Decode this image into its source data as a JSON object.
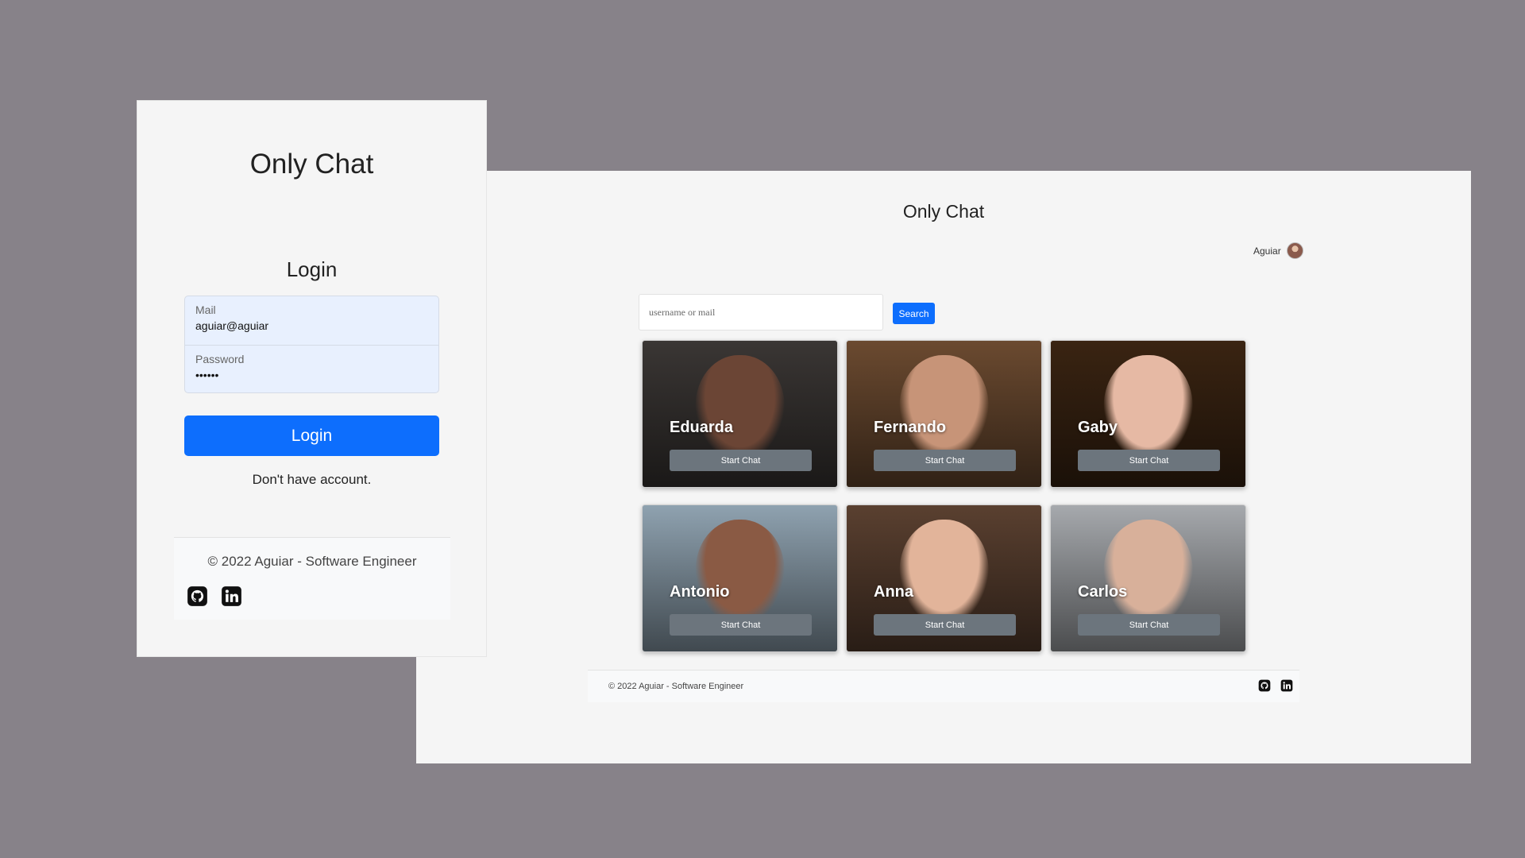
{
  "main": {
    "title": "Only Chat",
    "user": {
      "name": "Aguiar"
    },
    "search": {
      "placeholder": "username or mail",
      "button_label": "Search"
    },
    "cards": [
      {
        "name": "Eduarda",
        "button_label": "Start Chat",
        "bg": "#3a3634",
        "face": "#6b4535"
      },
      {
        "name": "Fernando",
        "button_label": "Start Chat",
        "bg": "#6b4a30",
        "face": "#c79478"
      },
      {
        "name": "Gaby",
        "button_label": "Start Chat",
        "bg": "#3a2412",
        "face": "#e6b9a4"
      },
      {
        "name": "Antonio",
        "button_label": "Start Chat",
        "bg": "#8fa2b0",
        "face": "#8a5a44"
      },
      {
        "name": "Anna",
        "button_label": "Start Chat",
        "bg": "#5a4030",
        "face": "#e2b49a"
      },
      {
        "name": "Carlos",
        "button_label": "Start Chat",
        "bg": "#a6a9ad",
        "face": "#d8b09a"
      }
    ],
    "footer": {
      "copyright": "© 2022 Aguiar - Software Engineer"
    }
  },
  "login": {
    "app_title": "Only Chat",
    "heading": "Login",
    "mail": {
      "label": "Mail",
      "value": "aguiar@aguiar"
    },
    "password": {
      "label": "Password",
      "value": "••••••"
    },
    "button_label": "Login",
    "signup_link": "Don't have account.",
    "footer": {
      "copyright": "© 2022 Aguiar - Software Engineer"
    }
  },
  "icons": {
    "github": "github-icon",
    "linkedin": "linkedin-icon"
  }
}
